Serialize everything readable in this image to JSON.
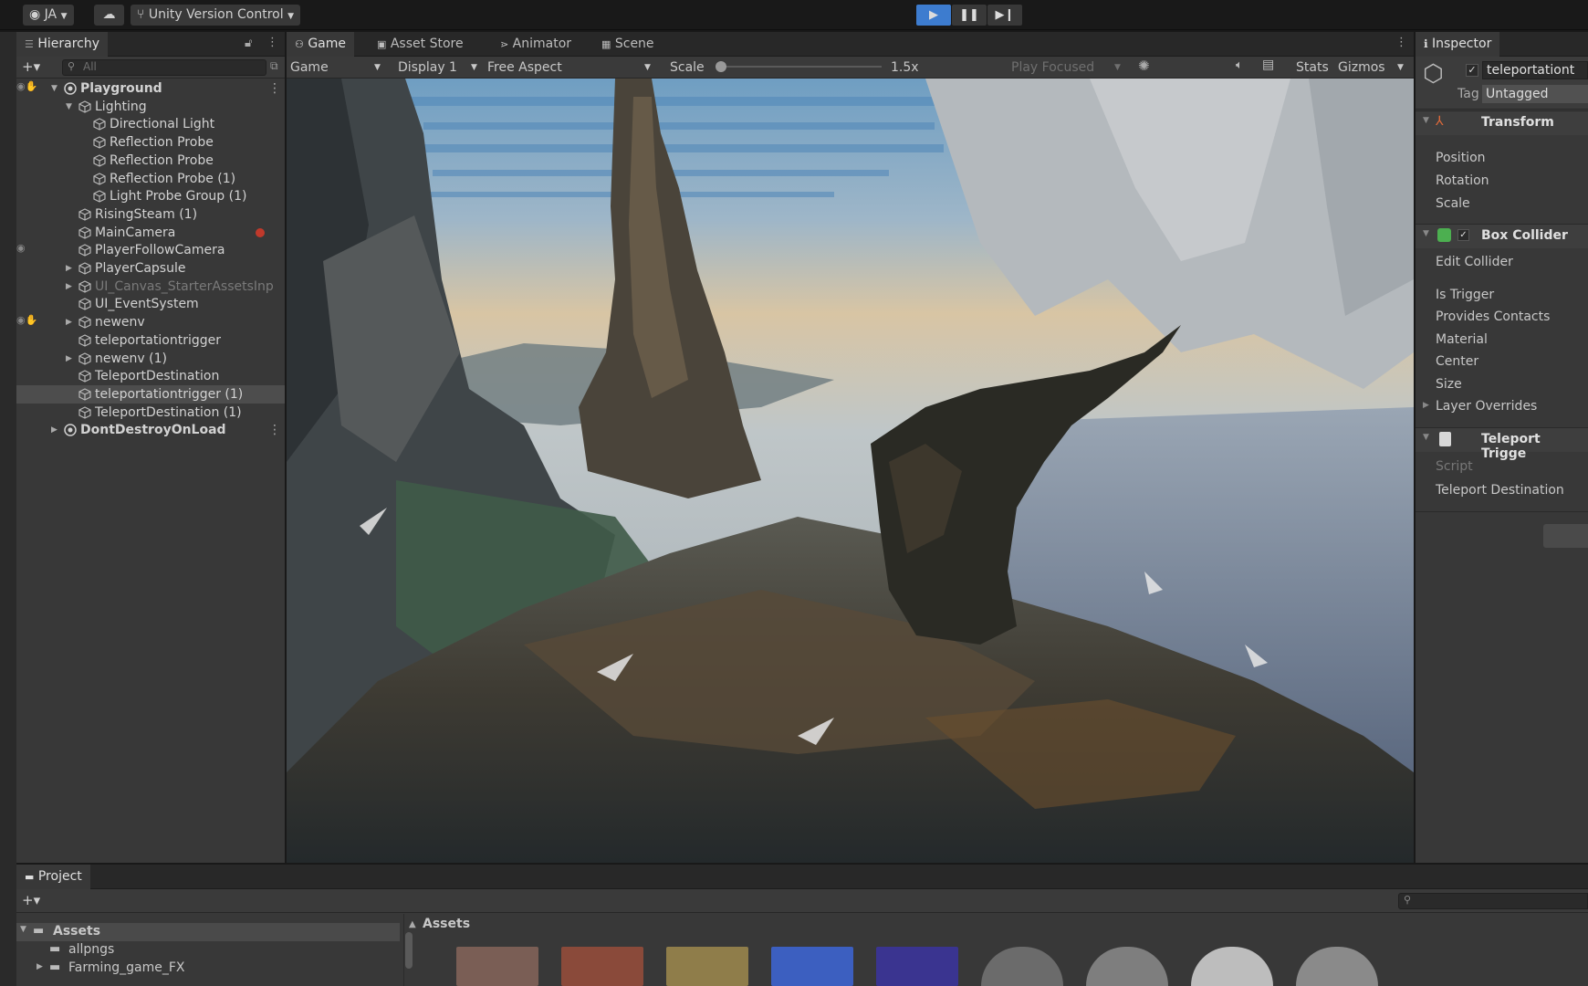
{
  "toolbar": {
    "account": "JA",
    "version_control": "Unity Version Control"
  },
  "hierarchy": {
    "tab": "Hierarchy",
    "search_placeholder": "All",
    "items": [
      {
        "label": "Playground",
        "depth": 0
      },
      {
        "label": "Lighting",
        "depth": 1
      },
      {
        "label": "Directional Light",
        "depth": 2
      },
      {
        "label": "Reflection Probe",
        "depth": 2
      },
      {
        "label": "Reflection Probe",
        "depth": 2
      },
      {
        "label": "Reflection Probe (1)",
        "depth": 2
      },
      {
        "label": "Light Probe Group (1)",
        "depth": 2
      },
      {
        "label": "RisingSteam (1)",
        "depth": 1
      },
      {
        "label": "MainCamera",
        "depth": 1
      },
      {
        "label": "PlayerFollowCamera",
        "depth": 1
      },
      {
        "label": "PlayerCapsule",
        "depth": 1
      },
      {
        "label": "UI_Canvas_StarterAssetsInp",
        "depth": 1
      },
      {
        "label": "UI_EventSystem",
        "depth": 1
      },
      {
        "label": "newenv",
        "depth": 1
      },
      {
        "label": "teleportationtrigger",
        "depth": 1
      },
      {
        "label": "newenv (1)",
        "depth": 1
      },
      {
        "label": "TeleportDestination",
        "depth": 1
      },
      {
        "label": "teleportationtrigger (1)",
        "depth": 1
      },
      {
        "label": "TeleportDestination (1)",
        "depth": 1
      },
      {
        "label": "DontDestroyOnLoad",
        "depth": 0
      }
    ]
  },
  "game": {
    "tabs": [
      "Game",
      "Asset Store",
      "Animator",
      "Scene"
    ],
    "mode": "Game",
    "display": "Display 1",
    "aspect": "Free Aspect",
    "scale_label": "Scale",
    "scale_value": "1.5x",
    "scale_fraction": 0.0,
    "play_focused": "Play Focused",
    "stats": "Stats",
    "gizmos": "Gizmos"
  },
  "inspector": {
    "tab": "Inspector",
    "object_name": "teleportationt",
    "tag_label": "Tag",
    "tag_value": "Untagged",
    "transform": {
      "title": "Transform",
      "fields": [
        "Position",
        "Rotation",
        "Scale"
      ]
    },
    "box_collider": {
      "title": "Box Collider",
      "fields": [
        "Edit Collider",
        "Is Trigger",
        "Provides Contacts",
        "Material",
        "Center",
        "Size",
        "Layer Overrides"
      ]
    },
    "teleport": {
      "title": "Teleport Trigge",
      "fields": [
        "Script",
        "Teleport Destination"
      ]
    }
  },
  "project": {
    "tab": "Project",
    "folders": [
      "Assets",
      "allpngs",
      "Farming_game_FX"
    ],
    "breadcrumb": "Assets",
    "thumb_count": 9
  },
  "colors": {
    "accent": "#3d7ccf",
    "panel": "#383838",
    "toolbar": "#191919",
    "selection": "#4d4d4d"
  }
}
